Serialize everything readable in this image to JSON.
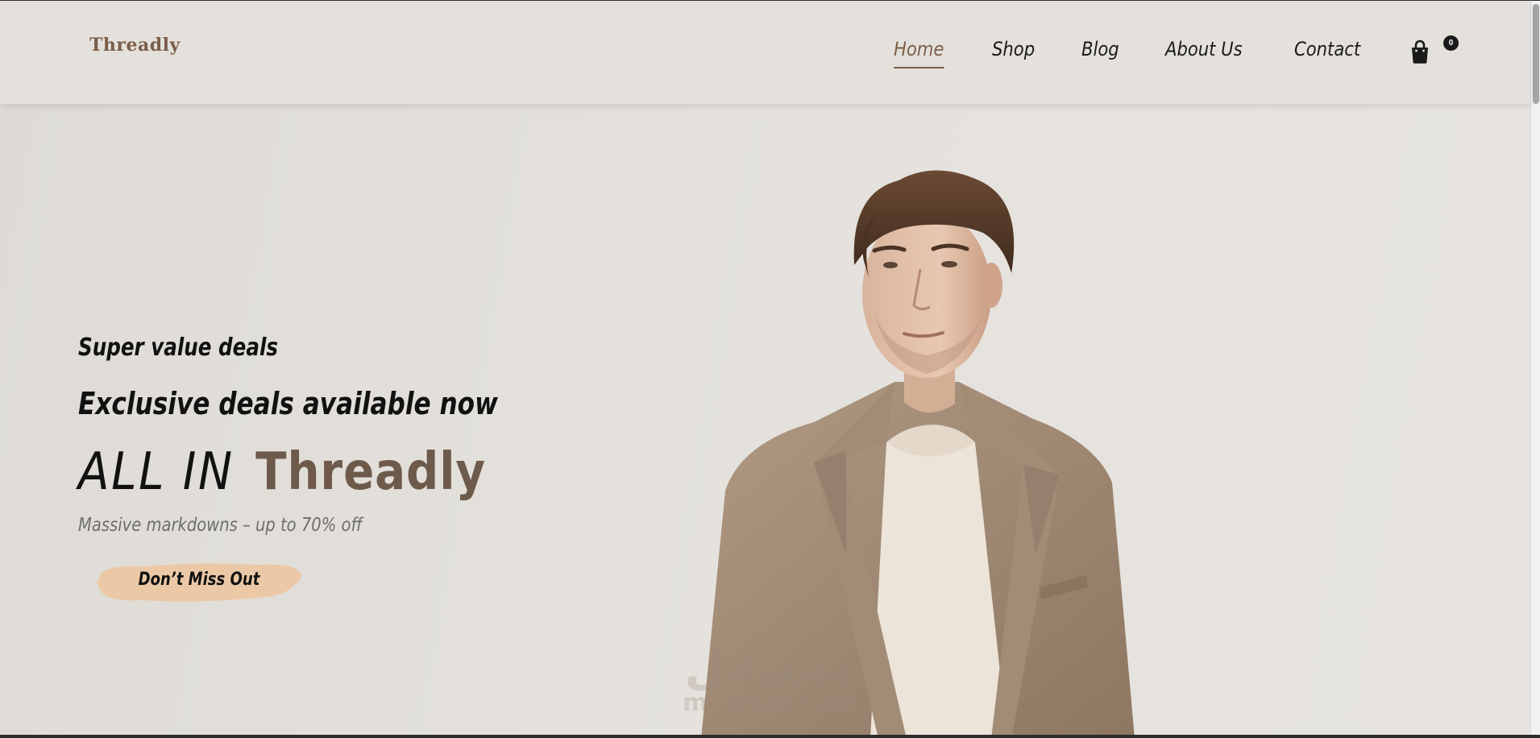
{
  "brand": {
    "logo": "Threadly",
    "accent": "#7a5e49"
  },
  "nav": {
    "items": [
      {
        "label": "Home",
        "active": true
      },
      {
        "label": "Shop",
        "active": false
      },
      {
        "label": "Blog",
        "active": false
      },
      {
        "label": "About Us",
        "active": false
      },
      {
        "label": "Contact",
        "active": false
      }
    ],
    "cart_icon": "shopping-bag-icon",
    "cart_count": "0"
  },
  "hero": {
    "eyebrow": "Super value deals",
    "subhead": "Exclusive deals available now",
    "headline_part1": "ALL IN",
    "headline_part2": "Threadly",
    "tagline": "Massive markdowns – up to 70% off",
    "cta_label": "Don’t Miss Out",
    "cta_color": "#ecc9a6"
  },
  "watermark": {
    "arabic": "مستقل",
    "latin": "mostaql.com"
  }
}
